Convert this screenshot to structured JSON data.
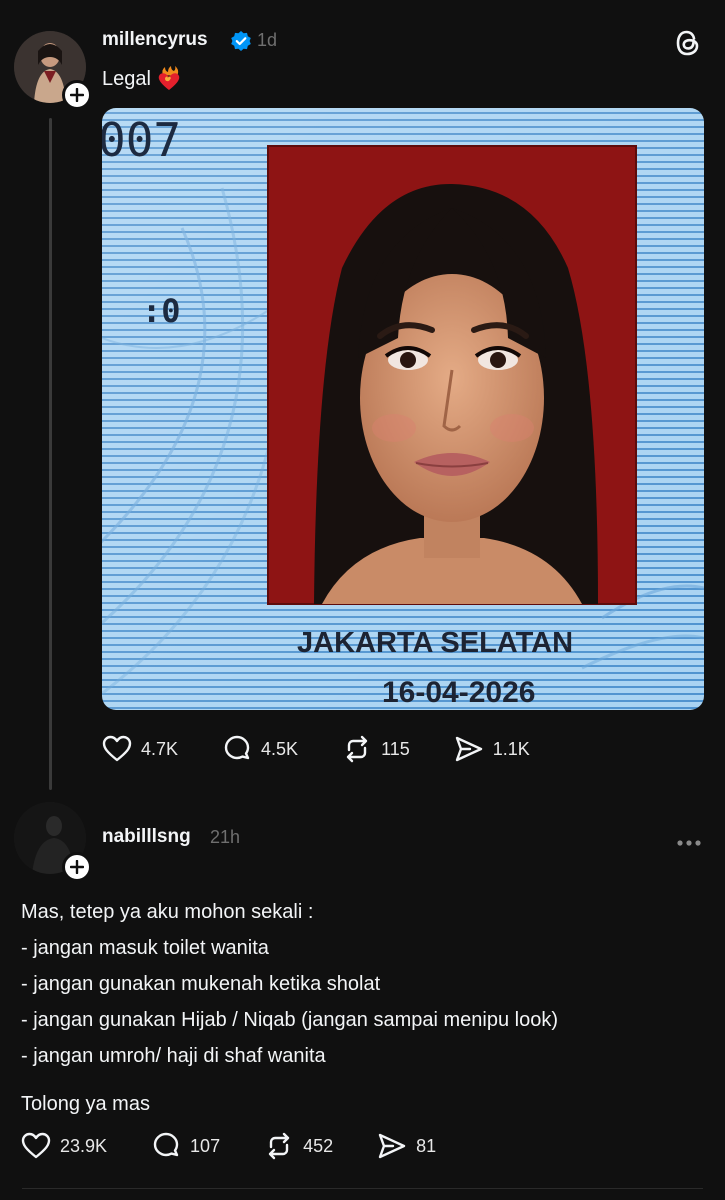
{
  "post1": {
    "username": "millencyrus",
    "verified": true,
    "time": "1d",
    "caption": "Legal",
    "caption_emoji": "heart-on-fire",
    "photo": {
      "corner_number": "007",
      "mark": ":0",
      "city": "JAKARTA SELATAN",
      "date": "16-04-2026"
    },
    "likes": "4.7K",
    "comments": "4.5K",
    "reposts": "115",
    "shares": "1.1K"
  },
  "post2": {
    "username": "nabilllsng",
    "time": "21h",
    "lines": [
      "Mas, tetep ya aku mohon sekali :",
      "- jangan masuk toilet wanita",
      "- jangan gunakan mukenah ketika sholat",
      "- jangan gunakan Hijab / Niqab (jangan sampai menipu look)",
      "- jangan umroh/ haji di shaf wanita"
    ],
    "closing": "Tolong ya mas",
    "likes": "23.9K",
    "comments": "107",
    "reposts": "452",
    "shares": "81"
  },
  "colors": {
    "background": "#101010",
    "verified_blue": "#0095f6",
    "muted_text": "#6f6f6f",
    "id_blue": "#8fc3ec",
    "photo_red": "#8e1414"
  }
}
